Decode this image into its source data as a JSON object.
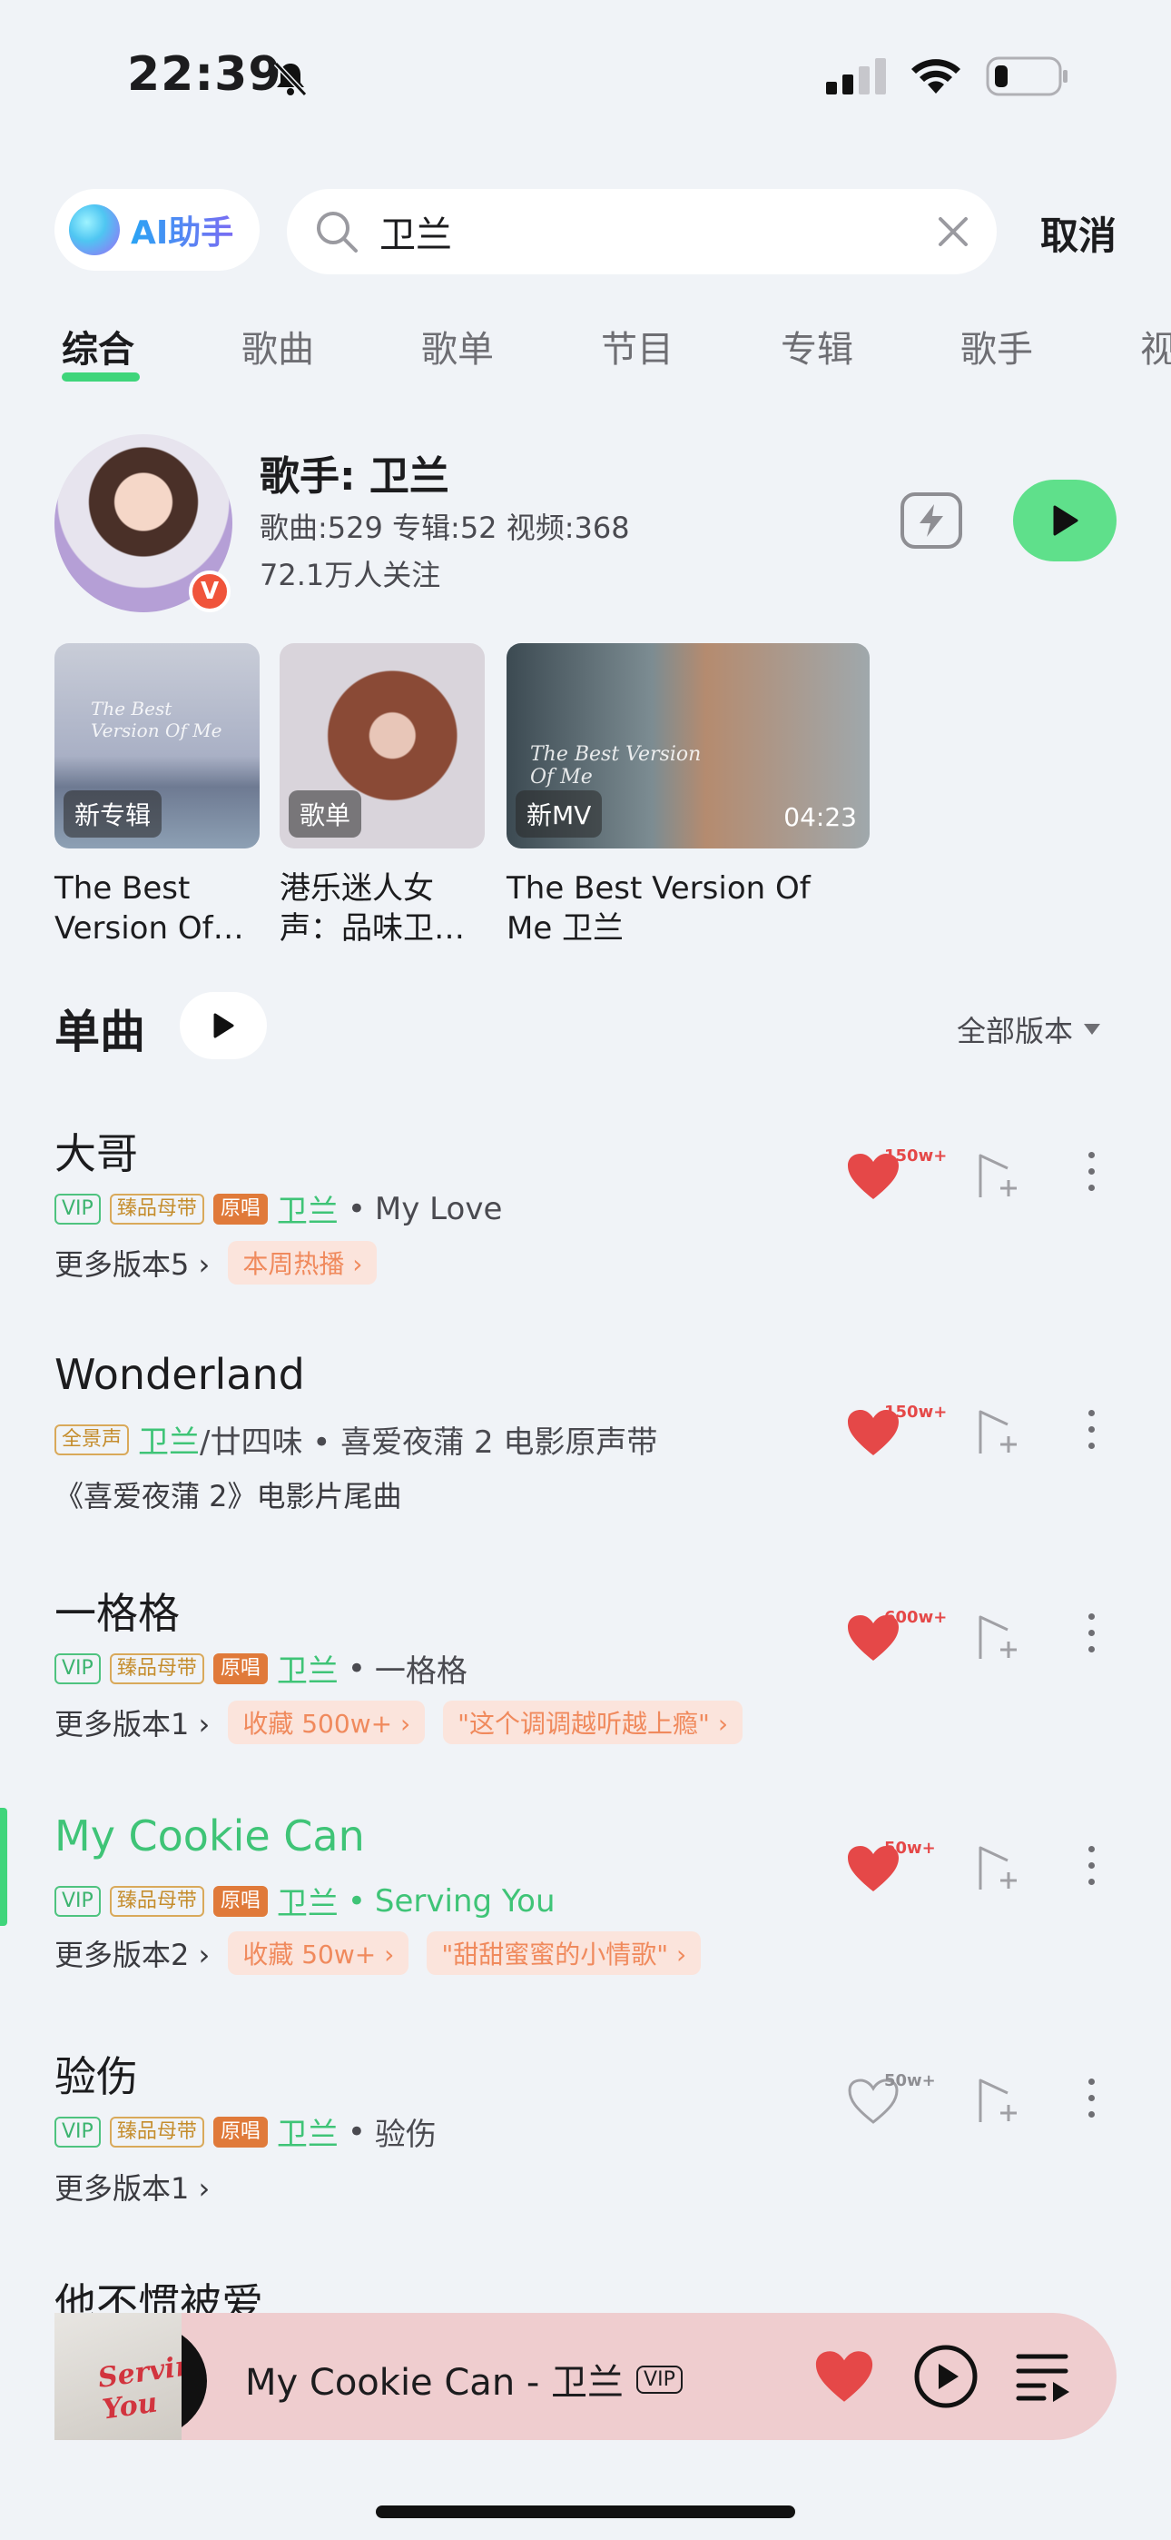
{
  "status": {
    "time": "22:39"
  },
  "search": {
    "ai_label": "AI助手",
    "query": "卫兰",
    "cancel": "取消"
  },
  "tabs": [
    "综合",
    "歌曲",
    "歌单",
    "节目",
    "专辑",
    "歌手",
    "视"
  ],
  "artist": {
    "title": "歌手: 卫兰",
    "stats": "歌曲:529 专辑:52 视频:368",
    "fans": "72.1万人关注",
    "badge": "V"
  },
  "cards": [
    {
      "tag": "新专辑",
      "title_l1": "The Best",
      "title_l2": "Version Of…",
      "script": "The Best Version Of Me"
    },
    {
      "tag": "歌单",
      "title_l1": "港乐迷人女",
      "title_l2": "声：品味卫…"
    },
    {
      "tag": "新MV",
      "duration": "04:23",
      "title_l1": "The Best Version Of",
      "title_l2": "Me 卫兰",
      "script": "The Best Version Of Me"
    }
  ],
  "singles": {
    "header": "单曲",
    "versions": "全部版本"
  },
  "songs": [
    {
      "title": "大哥",
      "artist": "卫兰",
      "sep": "•",
      "album": "My Love",
      "badges": [
        "VIP",
        "臻品母带",
        "原唱"
      ],
      "more": "更多版本5",
      "pills": [
        "本周热播"
      ],
      "likes": "150w+"
    },
    {
      "title": "Wonderland",
      "artist": "卫兰",
      "extra": "/廿四味 • 喜爱夜蒲 2 电影原声带",
      "badges": [
        "全景声"
      ],
      "more": "《喜爱夜蒲 2》电影片尾曲",
      "likes": "150w+"
    },
    {
      "title": "一格格",
      "artist": "卫兰",
      "sep": "•",
      "album": "一格格",
      "badges": [
        "VIP",
        "臻品母带",
        "原唱"
      ],
      "more": "更多版本1",
      "pills": [
        "收藏 500w+",
        "\"这个调调越听越上瘾\""
      ],
      "likes": "600w+"
    },
    {
      "title": "My Cookie Can",
      "artist": "卫兰",
      "sep": "•",
      "album": "Serving You",
      "badges": [
        "VIP",
        "臻品母带",
        "原唱"
      ],
      "more": "更多版本2",
      "pills": [
        "收藏 50w+",
        "\"甜甜蜜蜜的小情歌\""
      ],
      "likes": "50w+"
    },
    {
      "title": "验伤",
      "artist": "卫兰",
      "sep": "•",
      "album": "验伤",
      "badges": [
        "VIP",
        "臻品母带",
        "原唱"
      ],
      "more": "更多版本1",
      "likes": "50w+"
    },
    {
      "title": "他不惯被爱"
    }
  ],
  "player": {
    "title": "My Cookie Can - 卫兰",
    "vip": "VIP",
    "cover_text": "Serving You"
  },
  "colors": {
    "accent": "#3fd57b",
    "like": "#e54848",
    "player_bg": "#efcdcf"
  }
}
